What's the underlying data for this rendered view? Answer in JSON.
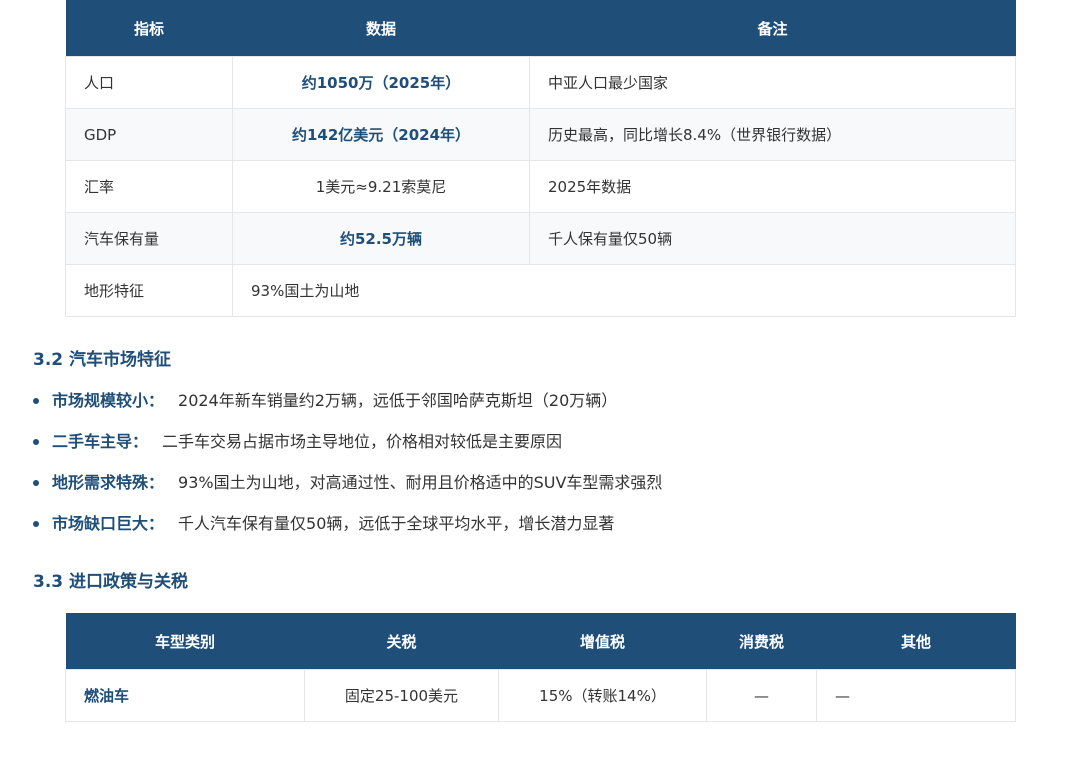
{
  "table1": {
    "headers": [
      "指标",
      "数据",
      "备注"
    ],
    "rows": [
      {
        "label": "人口",
        "value": "约1050万（2025年）",
        "note": "中亚人口最少国家"
      },
      {
        "label": "GDP",
        "value": "约142亿美元（2024年）",
        "note": "历史最高，同比增长8.4%（世界银行数据）"
      },
      {
        "label": "汇率",
        "value": "1美元≈9.21索莫尼",
        "note": "2025年数据"
      },
      {
        "label": "汽车保有量",
        "value": "约52.5万辆",
        "note": "千人保有量仅50辆"
      },
      {
        "label": "地形特征",
        "value": "93%国土为山地",
        "note": ""
      }
    ]
  },
  "section32": {
    "title": "3.2 汽车市场特征",
    "bullets": [
      {
        "label": "市场规模较小：",
        "text": "2024年新车销量约2万辆，远低于邻国哈萨克斯坦（20万辆）"
      },
      {
        "label": "二手车主导：",
        "text": "二手车交易占据市场主导地位，价格相对较低是主要原因"
      },
      {
        "label": "地形需求特殊：",
        "text": "93%国土为山地，对高通过性、耐用且价格适中的SUV车型需求强烈"
      },
      {
        "label": "市场缺口巨大：",
        "text": "千人汽车保有量仅50辆，远低于全球平均水平，增长潜力显著"
      }
    ]
  },
  "section33": {
    "title": "3.3 进口政策与关税"
  },
  "table2": {
    "headers": [
      "车型类别",
      "关税",
      "增值税",
      "消费税",
      "其他"
    ],
    "rows": [
      {
        "type": "燃油车",
        "tariff": "固定25-100美元",
        "vat": "15%（转账14%）",
        "excise": "—",
        "other": "—"
      }
    ]
  }
}
